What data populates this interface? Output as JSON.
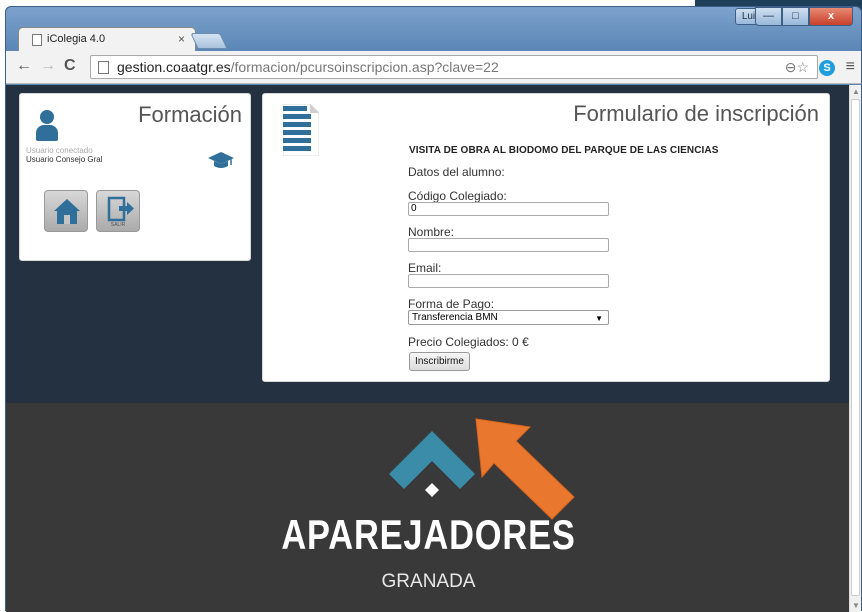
{
  "browser": {
    "tab_title": "iColegia 4.0",
    "tab_close": "×",
    "user_badge": "Luis",
    "win_min": "—",
    "win_max": "□",
    "win_close": "x",
    "url_host": "gestion.coaatgr.es",
    "url_path": "/formacion/pcursoinscripcion.asp?clave=22",
    "back": "←",
    "forward": "→",
    "reload": "C",
    "omnibox_tools": "⊖☆",
    "skype": "S",
    "menu": "≡"
  },
  "sidebar": {
    "title": "Formación",
    "connected_label": "Usuario conectado",
    "connected_user": "Usuario Consejo Gral",
    "exit_label": "SALIR"
  },
  "form": {
    "title": "Formulario de inscripción",
    "course": "VISITA DE OBRA AL BIODOMO DEL PARQUE DE LAS CIENCIAS",
    "section": "Datos del alumno:",
    "codigo_label": "Código Colegiado:",
    "codigo_value": "0",
    "nombre_label": "Nombre:",
    "nombre_value": "",
    "email_label": "Email:",
    "email_value": "",
    "pago_label": "Forma de Pago:",
    "pago_value": "Transferencia BMN",
    "price": "Precio Colegiados: 0 €",
    "submit": "Inscribirme"
  },
  "footer": {
    "brand": "APAREJADORES",
    "city": "GRANADA",
    "brand_color": "#3a8ca8"
  },
  "colors": {
    "page_bg": "#233140",
    "accent": "#2f6f99",
    "annotation_arrow": "#e9772e"
  }
}
